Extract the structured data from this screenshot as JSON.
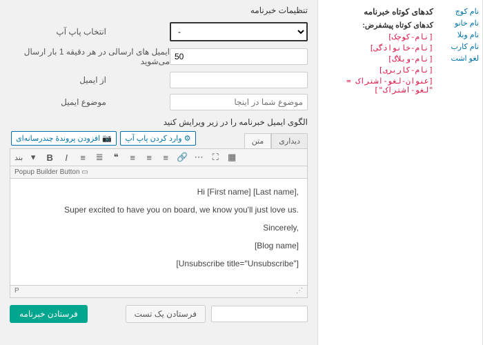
{
  "sidebar": {
    "title": "کدهای کوتاه خبرنامه",
    "subtitle": "کدهای کوتاه پیشفرض:",
    "shortcodes": [
      "[نام-کوچک]",
      "[نام-خانوادگی]",
      "[نام-وبلاگ]",
      "[نام-کاربری]",
      "[عنوان-لغو-اشتراک = \"لغو-اشتراک\"]"
    ]
  },
  "rightcol": {
    "items": [
      "نام کوچ",
      "نام خانو",
      "نام وبلا",
      "نام کارب",
      "لغو اشت"
    ]
  },
  "panel": {
    "title": "تنظیمات خبرنامه",
    "popup_label": "انتخاب پاپ آپ",
    "popup_value": "-",
    "permin_label": "ایمیل های ارسالی در هر دقیقه 1 بار ارسال می‌شوید",
    "permin_value": "50",
    "from_label": "از ایمیل",
    "subject_label": "موضوع ایمیل",
    "subject_placeholder": "موضوع شما در اینجا",
    "hint": "الگوی ایمیل خبرنامه را در زیر ویرایش کنید"
  },
  "media": {
    "add": "افزودن پروندۀ چندرسانه‌ای",
    "popup": "وارد کردن پاپ آپ"
  },
  "tabs": {
    "visual": "دیداری",
    "text": "متن"
  },
  "toolbar": {
    "paragraph": "بند",
    "popup_button": "Popup Builder Button"
  },
  "body": {
    "l1": "Hi [First name] [Last name],",
    "l2": "Super excited to have you on board, we know you'll just love us.",
    "l3": "Sincerely,",
    "l4": "[Blog name]",
    "l5": "[Unsubscribe title=\"Unsubscribe\"]"
  },
  "status": {
    "p": "P"
  },
  "bottom": {
    "send": "فرستادن خبرنامه",
    "test": "فرستادن یک تست"
  },
  "chart_data": null
}
